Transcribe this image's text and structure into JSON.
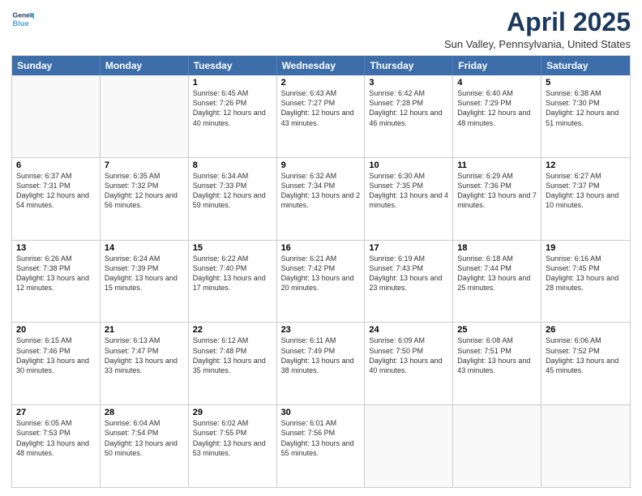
{
  "header": {
    "logo_line1": "General",
    "logo_line2": "Blue",
    "month_title": "April 2025",
    "location": "Sun Valley, Pennsylvania, United States"
  },
  "weekdays": [
    "Sunday",
    "Monday",
    "Tuesday",
    "Wednesday",
    "Thursday",
    "Friday",
    "Saturday"
  ],
  "rows": [
    [
      {
        "day": "",
        "sunrise": "",
        "sunset": "",
        "daylight": ""
      },
      {
        "day": "",
        "sunrise": "",
        "sunset": "",
        "daylight": ""
      },
      {
        "day": "1",
        "sunrise": "Sunrise: 6:45 AM",
        "sunset": "Sunset: 7:26 PM",
        "daylight": "Daylight: 12 hours and 40 minutes."
      },
      {
        "day": "2",
        "sunrise": "Sunrise: 6:43 AM",
        "sunset": "Sunset: 7:27 PM",
        "daylight": "Daylight: 12 hours and 43 minutes."
      },
      {
        "day": "3",
        "sunrise": "Sunrise: 6:42 AM",
        "sunset": "Sunset: 7:28 PM",
        "daylight": "Daylight: 12 hours and 46 minutes."
      },
      {
        "day": "4",
        "sunrise": "Sunrise: 6:40 AM",
        "sunset": "Sunset: 7:29 PM",
        "daylight": "Daylight: 12 hours and 48 minutes."
      },
      {
        "day": "5",
        "sunrise": "Sunrise: 6:38 AM",
        "sunset": "Sunset: 7:30 PM",
        "daylight": "Daylight: 12 hours and 51 minutes."
      }
    ],
    [
      {
        "day": "6",
        "sunrise": "Sunrise: 6:37 AM",
        "sunset": "Sunset: 7:31 PM",
        "daylight": "Daylight: 12 hours and 54 minutes."
      },
      {
        "day": "7",
        "sunrise": "Sunrise: 6:35 AM",
        "sunset": "Sunset: 7:32 PM",
        "daylight": "Daylight: 12 hours and 56 minutes."
      },
      {
        "day": "8",
        "sunrise": "Sunrise: 6:34 AM",
        "sunset": "Sunset: 7:33 PM",
        "daylight": "Daylight: 12 hours and 59 minutes."
      },
      {
        "day": "9",
        "sunrise": "Sunrise: 6:32 AM",
        "sunset": "Sunset: 7:34 PM",
        "daylight": "Daylight: 13 hours and 2 minutes."
      },
      {
        "day": "10",
        "sunrise": "Sunrise: 6:30 AM",
        "sunset": "Sunset: 7:35 PM",
        "daylight": "Daylight: 13 hours and 4 minutes."
      },
      {
        "day": "11",
        "sunrise": "Sunrise: 6:29 AM",
        "sunset": "Sunset: 7:36 PM",
        "daylight": "Daylight: 13 hours and 7 minutes."
      },
      {
        "day": "12",
        "sunrise": "Sunrise: 6:27 AM",
        "sunset": "Sunset: 7:37 PM",
        "daylight": "Daylight: 13 hours and 10 minutes."
      }
    ],
    [
      {
        "day": "13",
        "sunrise": "Sunrise: 6:26 AM",
        "sunset": "Sunset: 7:38 PM",
        "daylight": "Daylight: 13 hours and 12 minutes."
      },
      {
        "day": "14",
        "sunrise": "Sunrise: 6:24 AM",
        "sunset": "Sunset: 7:39 PM",
        "daylight": "Daylight: 13 hours and 15 minutes."
      },
      {
        "day": "15",
        "sunrise": "Sunrise: 6:22 AM",
        "sunset": "Sunset: 7:40 PM",
        "daylight": "Daylight: 13 hours and 17 minutes."
      },
      {
        "day": "16",
        "sunrise": "Sunrise: 6:21 AM",
        "sunset": "Sunset: 7:42 PM",
        "daylight": "Daylight: 13 hours and 20 minutes."
      },
      {
        "day": "17",
        "sunrise": "Sunrise: 6:19 AM",
        "sunset": "Sunset: 7:43 PM",
        "daylight": "Daylight: 13 hours and 23 minutes."
      },
      {
        "day": "18",
        "sunrise": "Sunrise: 6:18 AM",
        "sunset": "Sunset: 7:44 PM",
        "daylight": "Daylight: 13 hours and 25 minutes."
      },
      {
        "day": "19",
        "sunrise": "Sunrise: 6:16 AM",
        "sunset": "Sunset: 7:45 PM",
        "daylight": "Daylight: 13 hours and 28 minutes."
      }
    ],
    [
      {
        "day": "20",
        "sunrise": "Sunrise: 6:15 AM",
        "sunset": "Sunset: 7:46 PM",
        "daylight": "Daylight: 13 hours and 30 minutes."
      },
      {
        "day": "21",
        "sunrise": "Sunrise: 6:13 AM",
        "sunset": "Sunset: 7:47 PM",
        "daylight": "Daylight: 13 hours and 33 minutes."
      },
      {
        "day": "22",
        "sunrise": "Sunrise: 6:12 AM",
        "sunset": "Sunset: 7:48 PM",
        "daylight": "Daylight: 13 hours and 35 minutes."
      },
      {
        "day": "23",
        "sunrise": "Sunrise: 6:11 AM",
        "sunset": "Sunset: 7:49 PM",
        "daylight": "Daylight: 13 hours and 38 minutes."
      },
      {
        "day": "24",
        "sunrise": "Sunrise: 6:09 AM",
        "sunset": "Sunset: 7:50 PM",
        "daylight": "Daylight: 13 hours and 40 minutes."
      },
      {
        "day": "25",
        "sunrise": "Sunrise: 6:08 AM",
        "sunset": "Sunset: 7:51 PM",
        "daylight": "Daylight: 13 hours and 43 minutes."
      },
      {
        "day": "26",
        "sunrise": "Sunrise: 6:06 AM",
        "sunset": "Sunset: 7:52 PM",
        "daylight": "Daylight: 13 hours and 45 minutes."
      }
    ],
    [
      {
        "day": "27",
        "sunrise": "Sunrise: 6:05 AM",
        "sunset": "Sunset: 7:53 PM",
        "daylight": "Daylight: 13 hours and 48 minutes."
      },
      {
        "day": "28",
        "sunrise": "Sunrise: 6:04 AM",
        "sunset": "Sunset: 7:54 PM",
        "daylight": "Daylight: 13 hours and 50 minutes."
      },
      {
        "day": "29",
        "sunrise": "Sunrise: 6:02 AM",
        "sunset": "Sunset: 7:55 PM",
        "daylight": "Daylight: 13 hours and 53 minutes."
      },
      {
        "day": "30",
        "sunrise": "Sunrise: 6:01 AM",
        "sunset": "Sunset: 7:56 PM",
        "daylight": "Daylight: 13 hours and 55 minutes."
      },
      {
        "day": "",
        "sunrise": "",
        "sunset": "",
        "daylight": ""
      },
      {
        "day": "",
        "sunrise": "",
        "sunset": "",
        "daylight": ""
      },
      {
        "day": "",
        "sunrise": "",
        "sunset": "",
        "daylight": ""
      }
    ]
  ]
}
